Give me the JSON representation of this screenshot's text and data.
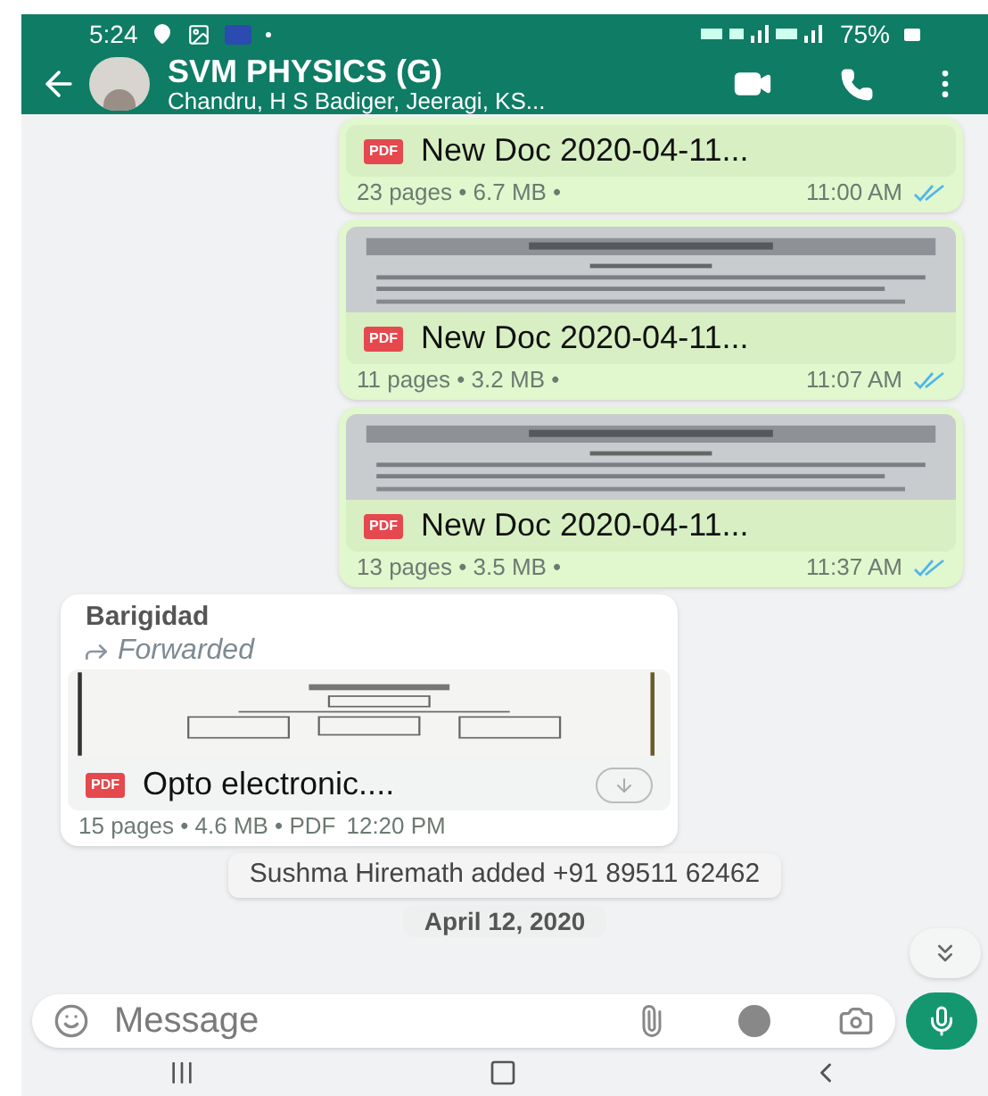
{
  "status_bar": {
    "time": "5:24",
    "battery": "75%"
  },
  "header": {
    "title": "SVM PHYSICS (G)",
    "subtitle": "Chandru, H S Badiger, Jeeragi, KS..."
  },
  "messages": [
    {
      "kind": "outgoing_document",
      "preview": false,
      "badge": "PDF",
      "filename": "New Doc 2020-04-11...",
      "meta": "23 pages • 6.7 MB •",
      "time": "11:00 AM",
      "read": true
    },
    {
      "kind": "outgoing_document",
      "preview": true,
      "badge": "PDF",
      "filename": "New Doc 2020-04-11...",
      "meta": "11 pages • 3.2 MB •",
      "time": "11:07 AM",
      "read": true
    },
    {
      "kind": "outgoing_document",
      "preview": true,
      "badge": "PDF",
      "filename": "New Doc 2020-04-11...",
      "meta": "13 pages • 3.5 MB •",
      "time": "11:37 AM",
      "read": true
    },
    {
      "kind": "incoming_document",
      "sender": "Barigidad",
      "forwarded_label": "Forwarded",
      "preview": true,
      "badge": "PDF",
      "filename": "Opto electronic....",
      "meta": "15 pages • 4.6 MB • PDF",
      "time": "12:20 PM",
      "downloadable": true
    },
    {
      "kind": "system",
      "text": "Sushma Hiremath added +91 89511 62462"
    },
    {
      "kind": "date",
      "text": "April 12, 2020"
    }
  ],
  "composer": {
    "placeholder": "Message"
  }
}
